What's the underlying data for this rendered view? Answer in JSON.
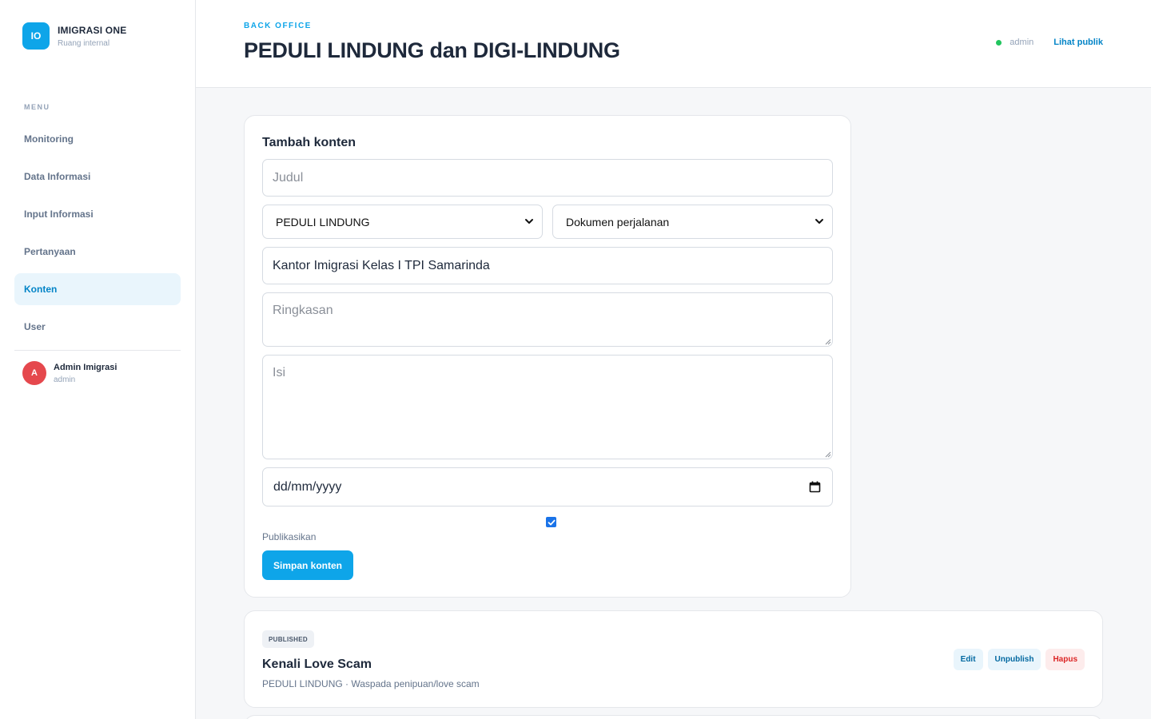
{
  "brand": {
    "logo": "IO",
    "name": "IMIGRASI ONE",
    "subtitle": "Ruang internal"
  },
  "sidebar": {
    "menu_label": "MENU",
    "items": [
      {
        "label": "Monitoring",
        "active": false
      },
      {
        "label": "Data Informasi",
        "active": false
      },
      {
        "label": "Input Informasi",
        "active": false
      },
      {
        "label": "Pertanyaan",
        "active": false
      },
      {
        "label": "Konten",
        "active": true
      },
      {
        "label": "User",
        "active": false
      }
    ],
    "user": {
      "initial": "A",
      "name": "Admin Imigrasi",
      "role": "admin"
    }
  },
  "header": {
    "eyebrow": "BACK OFFICE",
    "title": "PEDULI LINDUNG dan DIGI-LINDUNG",
    "user": "admin",
    "public_link": "Lihat publik"
  },
  "form": {
    "title": "Tambah konten",
    "judul_placeholder": "Judul",
    "program_value": "PEDULI LINDUNG",
    "kategori_value": "Dokumen perjalanan",
    "lokasi_value": "Kantor Imigrasi Kelas I TPI Samarinda",
    "ringkasan_placeholder": "Ringkasan",
    "isi_placeholder": "Isi",
    "date_placeholder": "dd/mm/yyyy",
    "publish_checked": true,
    "publish_label": "Publikasikan",
    "submit_label": "Simpan konten"
  },
  "contents": [
    {
      "status": "PUBLISHED",
      "title": "Kenali Love Scam",
      "meta": "PEDULI LINDUNG · Waspada penipuan/love scam",
      "actions": {
        "edit": "Edit",
        "unpublish": "Unpublish",
        "delete": "Hapus"
      }
    }
  ],
  "colors": {
    "accent": "#0ea5e9",
    "active_bg": "#e9f5fc",
    "danger": "#dc2626",
    "online": "#22c55e"
  }
}
